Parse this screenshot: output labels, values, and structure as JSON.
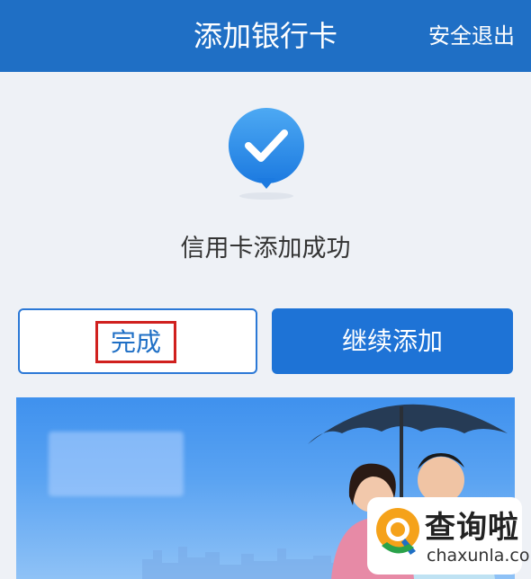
{
  "header": {
    "title": "添加银行卡",
    "logout_label": "安全退出"
  },
  "status": {
    "icon": "check-circle-icon",
    "message": "信用卡添加成功"
  },
  "actions": {
    "done_label": "完成",
    "continue_label": "继续添加"
  },
  "watermark": {
    "name": "查询啦",
    "url": "chaxunla.com"
  },
  "colors": {
    "brand_blue": "#1f6fc5",
    "button_blue": "#1e73d6",
    "highlight_red": "#d0201e",
    "logo_orange": "#f5a21a"
  }
}
